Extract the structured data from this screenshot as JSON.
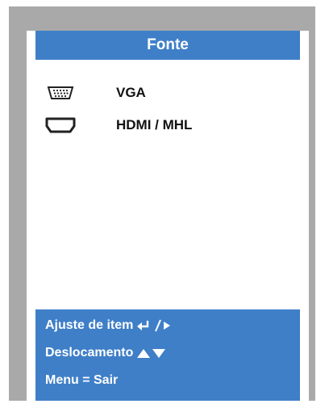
{
  "menu": {
    "title": "Fonte",
    "sources": [
      {
        "label": "VGA",
        "icon": "vga-port-icon"
      },
      {
        "label": "HDMI / MHL",
        "icon": "hdmi-port-icon"
      }
    ]
  },
  "help": {
    "adjust_label": "Ajuste de item",
    "scroll_label": "Deslocamento",
    "menu_exit_label": "Menu = Sair"
  },
  "colors": {
    "accent": "#3f7fc8",
    "frame": "#a9a9a9",
    "panel": "#ffffff"
  }
}
